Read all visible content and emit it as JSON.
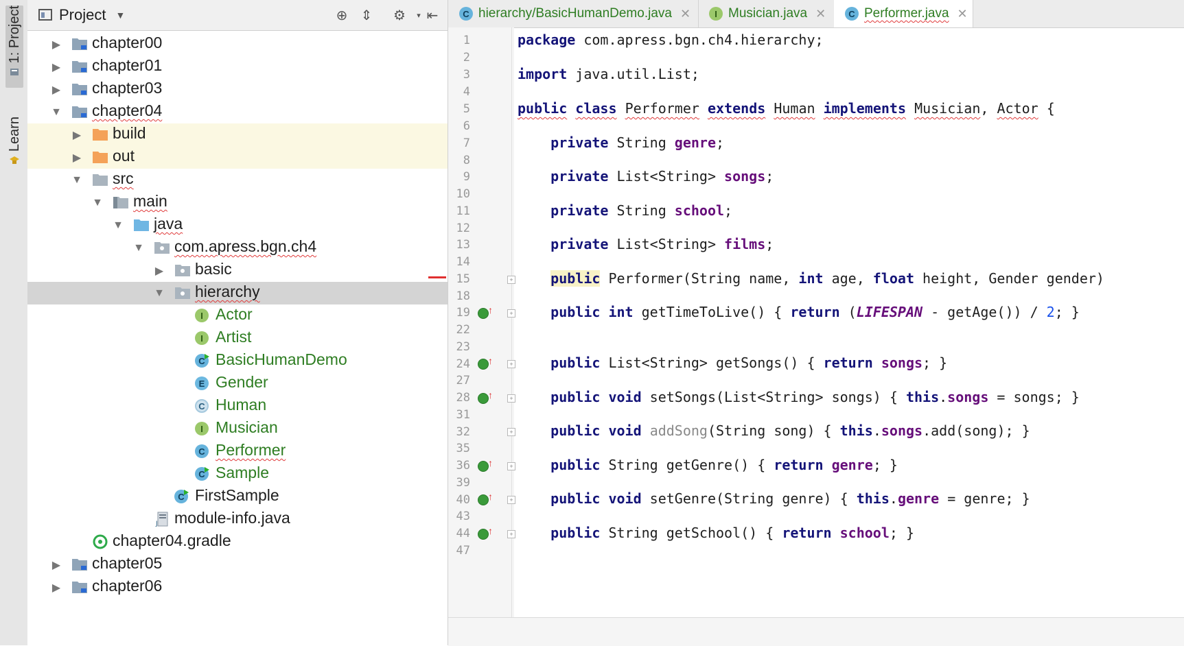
{
  "strip": {
    "project_label": "1: Project",
    "learn_label": "Learn"
  },
  "project_panel": {
    "title": "Project",
    "tree": [
      {
        "label": "chapter00",
        "level": 0,
        "expanded": false,
        "icon": "module-folder-icon"
      },
      {
        "label": "chapter01",
        "level": 0,
        "expanded": false,
        "icon": "module-folder-icon"
      },
      {
        "label": "chapter03",
        "level": 0,
        "expanded": false,
        "icon": "module-folder-icon"
      },
      {
        "label": "chapter04",
        "level": 0,
        "expanded": true,
        "icon": "module-folder-icon"
      },
      {
        "label": "build",
        "level": 1,
        "expanded": false,
        "icon": "excluded-folder-icon"
      },
      {
        "label": "out",
        "level": 1,
        "expanded": false,
        "icon": "excluded-folder-icon"
      },
      {
        "label": "src",
        "level": 1,
        "expanded": true,
        "icon": "folder-icon"
      },
      {
        "label": "main",
        "level": 2,
        "expanded": true,
        "icon": "folder-icon"
      },
      {
        "label": "java",
        "level": 3,
        "expanded": true,
        "icon": "source-folder-icon"
      },
      {
        "label": "com.apress.bgn.ch4",
        "level": 4,
        "expanded": true,
        "icon": "package-icon"
      },
      {
        "label": "basic",
        "level": 5,
        "expanded": false,
        "icon": "package-icon"
      },
      {
        "label": "hierarchy",
        "level": 5,
        "expanded": true,
        "icon": "package-icon"
      },
      {
        "label": "Actor",
        "level": 6,
        "icon": "interface-icon",
        "letter": "I"
      },
      {
        "label": "Artist",
        "level": 6,
        "icon": "interface-icon",
        "letter": "I"
      },
      {
        "label": "BasicHumanDemo",
        "level": 6,
        "icon": "runnable-class-icon",
        "letter": "C"
      },
      {
        "label": "Gender",
        "level": 6,
        "icon": "enum-icon",
        "letter": "E"
      },
      {
        "label": "Human",
        "level": 6,
        "icon": "abstract-class-icon",
        "letter": "C"
      },
      {
        "label": "Musician",
        "level": 6,
        "icon": "interface-icon",
        "letter": "I"
      },
      {
        "label": "Performer",
        "level": 6,
        "icon": "class-icon",
        "letter": "C"
      },
      {
        "label": "Sample",
        "level": 6,
        "icon": "runnable-class-icon",
        "letter": "C"
      },
      {
        "label": "FirstSample",
        "level": 5,
        "icon": "runnable-class-icon",
        "letter": "C"
      },
      {
        "label": "module-info.java",
        "level": 4,
        "icon": "module-info-icon"
      },
      {
        "label": "chapter04.gradle",
        "level": 2,
        "icon": "gradle-icon"
      },
      {
        "label": "chapter05",
        "level": 0,
        "expanded": false,
        "icon": "module-folder-icon"
      },
      {
        "label": "chapter06",
        "level": 0,
        "expanded": false,
        "icon": "module-folder-icon"
      }
    ]
  },
  "editor": {
    "tabs": [
      {
        "label": "hierarchy/BasicHumanDemo.java",
        "icon": "runnable-class-icon"
      },
      {
        "label": "Musician.java",
        "icon": "interface-icon"
      },
      {
        "label": "Performer.java",
        "icon": "class-icon",
        "active": true
      }
    ],
    "lines": [
      {
        "n": "1",
        "t": "package com.apress.bgn.ch4.hierarchy;"
      },
      {
        "n": "2",
        "t": ""
      },
      {
        "n": "3",
        "t": "import java.util.List;"
      },
      {
        "n": "4",
        "t": ""
      },
      {
        "n": "5",
        "t": "public class Performer extends Human implements Musician, Actor {"
      },
      {
        "n": "6",
        "t": ""
      },
      {
        "n": "7",
        "t": "    private String genre;"
      },
      {
        "n": "8",
        "t": ""
      },
      {
        "n": "9",
        "t": "    private List<String> songs;"
      },
      {
        "n": "10",
        "t": ""
      },
      {
        "n": "11",
        "t": "    private String school;"
      },
      {
        "n": "12",
        "t": ""
      },
      {
        "n": "13",
        "t": "    private List<String> films;"
      },
      {
        "n": "14",
        "t": ""
      },
      {
        "n": "15",
        "t": "    public Performer(String name, int age, float height, Gender gender)"
      },
      {
        "n": "18",
        "t": ""
      },
      {
        "n": "19",
        "t": "    public int getTimeToLive() { return (LIFESPAN - getAge()) / 2; }"
      },
      {
        "n": "22",
        "t": ""
      },
      {
        "n": "23",
        "t": ""
      },
      {
        "n": "24",
        "t": "    public List<String> getSongs() { return songs; }"
      },
      {
        "n": "27",
        "t": ""
      },
      {
        "n": "28",
        "t": "    public void setSongs(List<String> songs) { this.songs = songs; }"
      },
      {
        "n": "31",
        "t": ""
      },
      {
        "n": "32",
        "t": "    public void addSong(String song) { this.songs.add(song); }"
      },
      {
        "n": "35",
        "t": ""
      },
      {
        "n": "36",
        "t": "    public String getGenre() { return genre; }"
      },
      {
        "n": "39",
        "t": ""
      },
      {
        "n": "40",
        "t": "    public void setGenre(String genre) { this.genre = genre; }"
      },
      {
        "n": "43",
        "t": ""
      },
      {
        "n": "44",
        "t": "    public String getSchool() { return school; }"
      },
      {
        "n": "47",
        "t": ""
      }
    ]
  },
  "colors": {
    "keyword": "#141478",
    "field": "#660e7a",
    "number": "#1750eb",
    "excluded_row_bg": "#fbf8e2",
    "selected_row_bg": "#d4d4d4"
  }
}
